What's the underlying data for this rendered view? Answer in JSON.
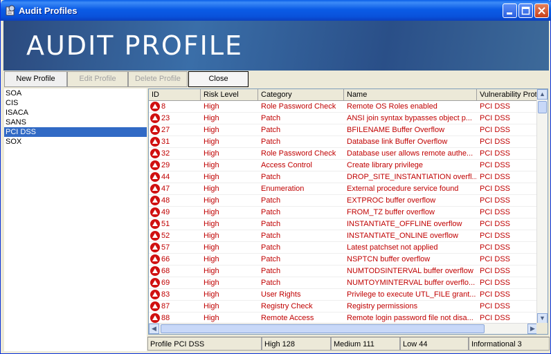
{
  "window": {
    "title": "Audit Profiles"
  },
  "banner": {
    "title": "AUDIT PROFILE"
  },
  "toolbar": {
    "new_profile": "New Profile",
    "edit_profile": "Edit Profile",
    "delete_profile": "Delete Profile",
    "close": "Close"
  },
  "profiles": [
    {
      "label": "SOA"
    },
    {
      "label": "CIS"
    },
    {
      "label": "ISACA"
    },
    {
      "label": "SANS"
    },
    {
      "label": "PCI DSS",
      "selected": true
    },
    {
      "label": "SOX"
    }
  ],
  "table": {
    "headers": [
      "ID",
      "Risk Level",
      "Category",
      "Name",
      "Vulnerability Prot"
    ],
    "rows": [
      [
        "8",
        "High",
        "Role Password Check",
        "Remote OS Roles enabled",
        "PCI DSS"
      ],
      [
        "23",
        "High",
        "Patch",
        "ANSI join syntax bypasses object p...",
        "PCI DSS"
      ],
      [
        "27",
        "High",
        "Patch",
        "BFILENAME Buffer Overflow",
        "PCI DSS"
      ],
      [
        "31",
        "High",
        "Patch",
        "Database link Buffer Overflow",
        "PCI DSS"
      ],
      [
        "32",
        "High",
        "Role Password Check",
        "Database user allows remote authe...",
        "PCI DSS"
      ],
      [
        "29",
        "High",
        "Access Control",
        "Create library privilege",
        "PCI DSS"
      ],
      [
        "44",
        "High",
        "Patch",
        "DROP_SITE_INSTANTIATION overfl...",
        "PCI DSS"
      ],
      [
        "47",
        "High",
        "Enumeration",
        "External procedure service found",
        "PCI DSS"
      ],
      [
        "48",
        "High",
        "Patch",
        "EXTPROC buffer overflow",
        "PCI DSS"
      ],
      [
        "49",
        "High",
        "Patch",
        "FROM_TZ buffer overflow",
        "PCI DSS"
      ],
      [
        "51",
        "High",
        "Patch",
        "INSTANTIATE_OFFLINE overflow",
        "PCI DSS"
      ],
      [
        "52",
        "High",
        "Patch",
        "INSTANTIATE_ONLINE overflow",
        "PCI DSS"
      ],
      [
        "57",
        "High",
        "Patch",
        "Latest patchset not applied",
        "PCI DSS"
      ],
      [
        "66",
        "High",
        "Patch",
        "NSPTCN buffer overflow",
        "PCI DSS"
      ],
      [
        "68",
        "High",
        "Patch",
        "NUMTODSINTERVAL buffer overflow",
        "PCI DSS"
      ],
      [
        "69",
        "High",
        "Patch",
        "NUMTOYMINTERVAL buffer overflo...",
        "PCI DSS"
      ],
      [
        "83",
        "High",
        "User Rights",
        "Privilege to execute UTL_FILE grant...",
        "PCI DSS"
      ],
      [
        "87",
        "High",
        "Registry Check",
        "Registry permissions",
        "PCI DSS"
      ],
      [
        "88",
        "High",
        "Remote Access",
        "Remote login password file not disa...",
        "PCI DSS"
      ]
    ]
  },
  "status": {
    "profile": "Profile PCI DSS",
    "high": "High 128",
    "medium": "Medium 111",
    "low": "Low 44",
    "info": "Informational 3"
  },
  "colors": {
    "risk_text": "#c00000",
    "selection": "#316ac5",
    "titlebar": "#0a5fe8"
  },
  "icons": {
    "risk": "high-risk-warning-icon",
    "app": "audit-app-icon"
  }
}
